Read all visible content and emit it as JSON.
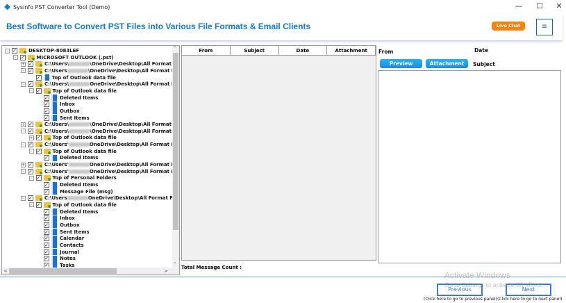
{
  "window": {
    "title": "Sysinfo PST Converter Tool (Demo)",
    "minimize": "—",
    "maximize": "☐",
    "close": "✕"
  },
  "banner": {
    "headline": "Best Software to Convert PST Files into Various File Formats & Email Clients",
    "live_chat": "Live Chat",
    "menu_icon": "≡"
  },
  "tree": [
    {
      "lvl": 0,
      "exp": "-",
      "icon": "folder",
      "text": "DESKTOP-8083LEF"
    },
    {
      "lvl": 1,
      "exp": "-",
      "icon": "folder",
      "text": "MICROSOFT OUTLOOK (.pst)"
    },
    {
      "lvl": 2,
      "exp": "+",
      "icon": "folder",
      "pre": "C:\\Users\\",
      "text": "\\OneDrive\\Desktop\\All Format Files\\M"
    },
    {
      "lvl": 2,
      "exp": "-",
      "icon": "folder",
      "pre": "C:\\Users",
      "text": "\\OneDrive\\Desktop\\All Format Files\\Ou"
    },
    {
      "lvl": 3,
      "exp": "",
      "icon": "blue",
      "text": "Top of Outlook data file"
    },
    {
      "lvl": 2,
      "exp": "-",
      "icon": "folder",
      "pre": "C:\\Users\\",
      "text": "OneDrive\\Desktop\\All Format Files\\Ou"
    },
    {
      "lvl": 3,
      "exp": "-",
      "icon": "folder",
      "text": "Top of Outlook data file"
    },
    {
      "lvl": 4,
      "exp": "",
      "icon": "blue",
      "text": "Deleted Items"
    },
    {
      "lvl": 4,
      "exp": "",
      "icon": "blue",
      "text": "Inbox"
    },
    {
      "lvl": 4,
      "exp": "",
      "icon": "blue",
      "text": "Outbox"
    },
    {
      "lvl": 4,
      "exp": "",
      "icon": "blue",
      "text": "Sent Items"
    },
    {
      "lvl": 2,
      "exp": "+",
      "icon": "folder",
      "pre": "C:\\Users\\",
      "text": "\\OneDrive\\Desktop\\All Format Files\\Ou"
    },
    {
      "lvl": 2,
      "exp": "-",
      "icon": "folder",
      "pre": "C:\\Users\\",
      "text": "\\OneDrive\\Desktop\\All Format Files\\Ou"
    },
    {
      "lvl": 3,
      "exp": "+",
      "icon": "folder",
      "text": "Top of Outlook data file"
    },
    {
      "lvl": 2,
      "exp": "-",
      "icon": "folder",
      "pre": "C:\\Users'",
      "text": "OneDrive\\Desktop\\All Format Files\\ne"
    },
    {
      "lvl": 3,
      "exp": "-",
      "icon": "folder",
      "text": "Top of Outlook data file"
    },
    {
      "lvl": 4,
      "exp": "",
      "icon": "blue",
      "text": "Deleted Items"
    },
    {
      "lvl": 2,
      "exp": "+",
      "icon": "folder",
      "pre": "C:\\Users'",
      "text": "OneDrive\\Desktop\\All Format Files\\AT"
    },
    {
      "lvl": 2,
      "exp": "-",
      "icon": "folder",
      "pre": "C:\\Users'",
      "text": "OneDrive\\Desktop\\All Format Files\\M"
    },
    {
      "lvl": 3,
      "exp": "-",
      "icon": "folder",
      "text": "Top of Personal Folders"
    },
    {
      "lvl": 4,
      "exp": "",
      "icon": "blue",
      "text": "Deleted Items"
    },
    {
      "lvl": 4,
      "exp": "",
      "icon": "blue",
      "text": "Message File (msg)"
    },
    {
      "lvl": 2,
      "exp": "-",
      "icon": "folder",
      "pre": "C:\\Users",
      "text": "OneDrive\\Desktop\\All Format Files\\ba"
    },
    {
      "lvl": 3,
      "exp": "-",
      "icon": "folder",
      "text": "Top of Outlook data file"
    },
    {
      "lvl": 4,
      "exp": "",
      "icon": "blue",
      "text": "Deleted Items"
    },
    {
      "lvl": 4,
      "exp": "",
      "icon": "blue",
      "text": "Inbox"
    },
    {
      "lvl": 4,
      "exp": "",
      "icon": "blue",
      "text": "Outbox"
    },
    {
      "lvl": 4,
      "exp": "",
      "icon": "blue",
      "text": "Sent Items"
    },
    {
      "lvl": 4,
      "exp": "",
      "icon": "blue",
      "text": "Calendar"
    },
    {
      "lvl": 4,
      "exp": "",
      "icon": "blue",
      "text": "Contacts"
    },
    {
      "lvl": 4,
      "exp": "",
      "icon": "blue",
      "text": "Journal"
    },
    {
      "lvl": 4,
      "exp": "",
      "icon": "blue",
      "text": "Notes"
    },
    {
      "lvl": 4,
      "exp": "",
      "icon": "blue",
      "text": "Tasks"
    }
  ],
  "grid": {
    "columns": [
      "From",
      "Subject",
      "Date",
      "Attachment"
    ],
    "total_label": "Total Message Count :"
  },
  "preview": {
    "from": "From",
    "date": "Date",
    "subject": "Subject",
    "preview_btn": "Preview",
    "attachment_btn": "Attachment"
  },
  "nav": {
    "previous": "Previous",
    "next": "Next",
    "previous_hint": "(Click here to go to previous panel)",
    "next_hint": "(Click here to go to next panel)"
  },
  "watermark": {
    "line1": "Activate Windows",
    "line2": "Go to Settings to activate Windows."
  }
}
